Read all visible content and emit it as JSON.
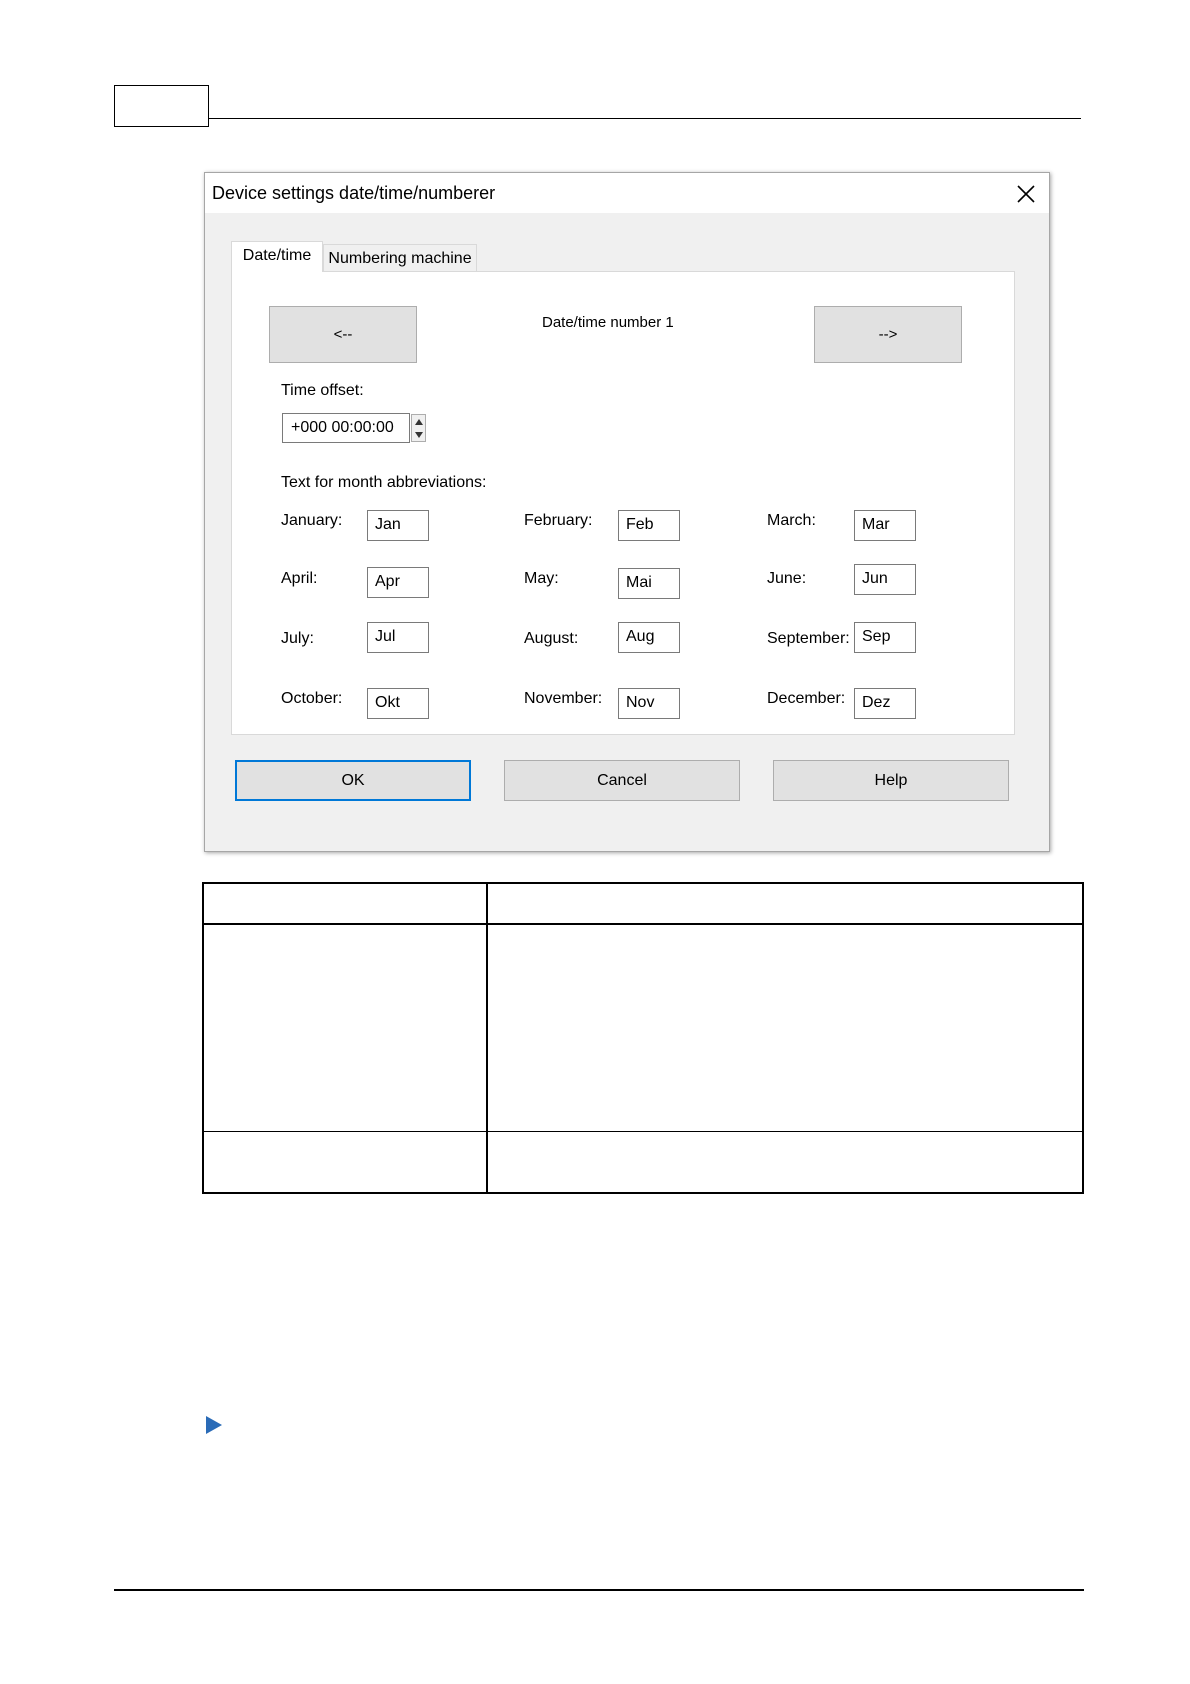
{
  "dialog": {
    "title": "Device settings date/time/numberer",
    "tabs": [
      {
        "label": "Date/time",
        "active": true
      },
      {
        "label": "Numbering machine",
        "active": false
      }
    ],
    "nav": {
      "prev_label": "<--",
      "next_label": "-->",
      "current_label": "Date/time number 1"
    },
    "time_offset": {
      "label": "Time offset:",
      "value": "+000 00:00:00"
    },
    "months_heading": "Text for month abbreviations:",
    "months": [
      {
        "label": "January:",
        "value": "Jan"
      },
      {
        "label": "February:",
        "value": "Feb"
      },
      {
        "label": "March:",
        "value": "Mar"
      },
      {
        "label": "April:",
        "value": "Apr"
      },
      {
        "label": "May:",
        "value": "Mai"
      },
      {
        "label": "June:",
        "value": "Jun"
      },
      {
        "label": "July:",
        "value": "Jul"
      },
      {
        "label": "August:",
        "value": "Aug"
      },
      {
        "label": "September:",
        "value": "Sep"
      },
      {
        "label": "October:",
        "value": "Okt"
      },
      {
        "label": "November:",
        "value": "Nov"
      },
      {
        "label": "December:",
        "value": "Dez"
      }
    ],
    "buttons": {
      "ok": "OK",
      "cancel": "Cancel",
      "help": "Help"
    }
  },
  "colors": {
    "dialog_bg": "#f0f0f0",
    "button_bg": "#e1e1e1",
    "focus_border": "#0078d7",
    "bullet": "#2a6bb7"
  },
  "icons": [
    "close-icon",
    "spin-up-icon",
    "spin-down-icon",
    "bullet-arrow-icon"
  ]
}
